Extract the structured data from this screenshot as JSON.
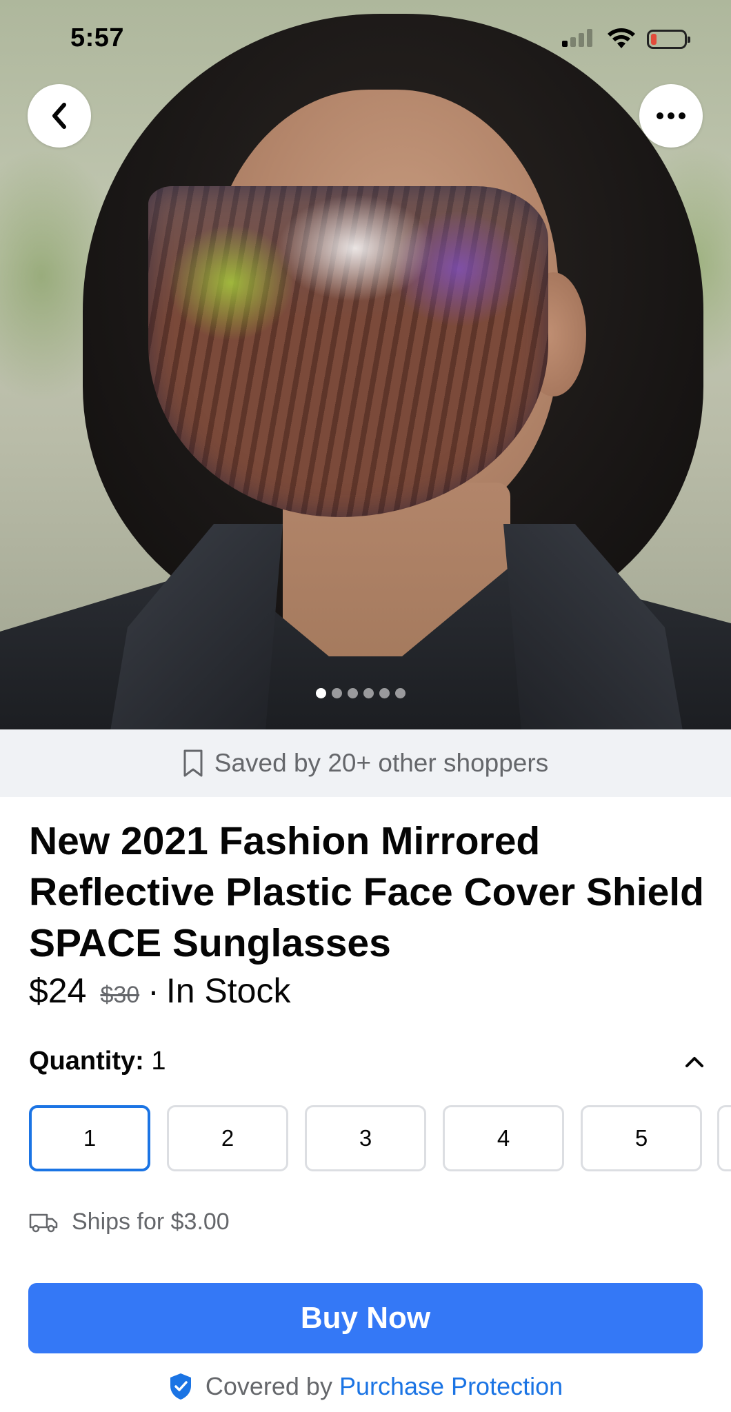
{
  "status_bar": {
    "time": "5:57"
  },
  "gallery": {
    "page_count": 6,
    "active_index": 0
  },
  "saved": {
    "text": "Saved by 20+ other shoppers"
  },
  "product": {
    "title": "New 2021 Fashion Mirrored Reflective Plastic Face Cover Shield SPACE Sunglasses",
    "price": "$24",
    "original_price": "$30",
    "separator": "·",
    "stock": "In Stock"
  },
  "quantity": {
    "label": "Quantity:",
    "value": "1",
    "options": [
      "1",
      "2",
      "3",
      "4",
      "5"
    ],
    "selected_index": 0
  },
  "shipping": {
    "text": "Ships for $3.00"
  },
  "buy": {
    "label": "Buy Now"
  },
  "protection": {
    "prefix": "Covered by",
    "link": "Purchase Protection"
  },
  "colors": {
    "accent": "#3478f6",
    "link": "#1b74e4",
    "secondary_text": "#65676b"
  }
}
